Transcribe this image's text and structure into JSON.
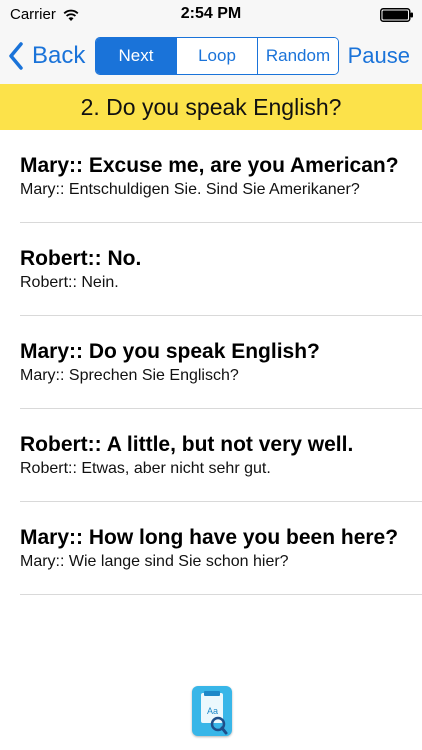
{
  "status_bar": {
    "carrier": "Carrier",
    "time": "2:54 PM"
  },
  "nav": {
    "back_label": "Back",
    "segments": [
      {
        "label": "Next",
        "selected": true
      },
      {
        "label": "Loop",
        "selected": false
      },
      {
        "label": "Random",
        "selected": false
      }
    ],
    "pause_label": "Pause"
  },
  "banner": {
    "title": "2. Do you speak English?"
  },
  "dialog": [
    {
      "en": "Mary:: Excuse me, are you American?",
      "de": "Mary:: Entschuldigen Sie. Sind Sie Amerikaner?"
    },
    {
      "en": "Robert:: No.",
      "de": "Robert:: Nein."
    },
    {
      "en": "Mary:: Do you speak English?",
      "de": "Mary:: Sprechen Sie Englisch?"
    },
    {
      "en": "Robert:: A little, but not very well.",
      "de": "Robert:: Etwas, aber nicht sehr gut."
    },
    {
      "en": "Mary:: How long have you been here?",
      "de": "Mary:: Wie lange sind Sie schon hier?"
    }
  ],
  "dictionary_button": {
    "icon": "dictionary-search-icon",
    "glyph": "Aa"
  },
  "colors": {
    "accent": "#1a73d9",
    "banner": "#fce24a",
    "dictionary": "#38b6e8"
  }
}
